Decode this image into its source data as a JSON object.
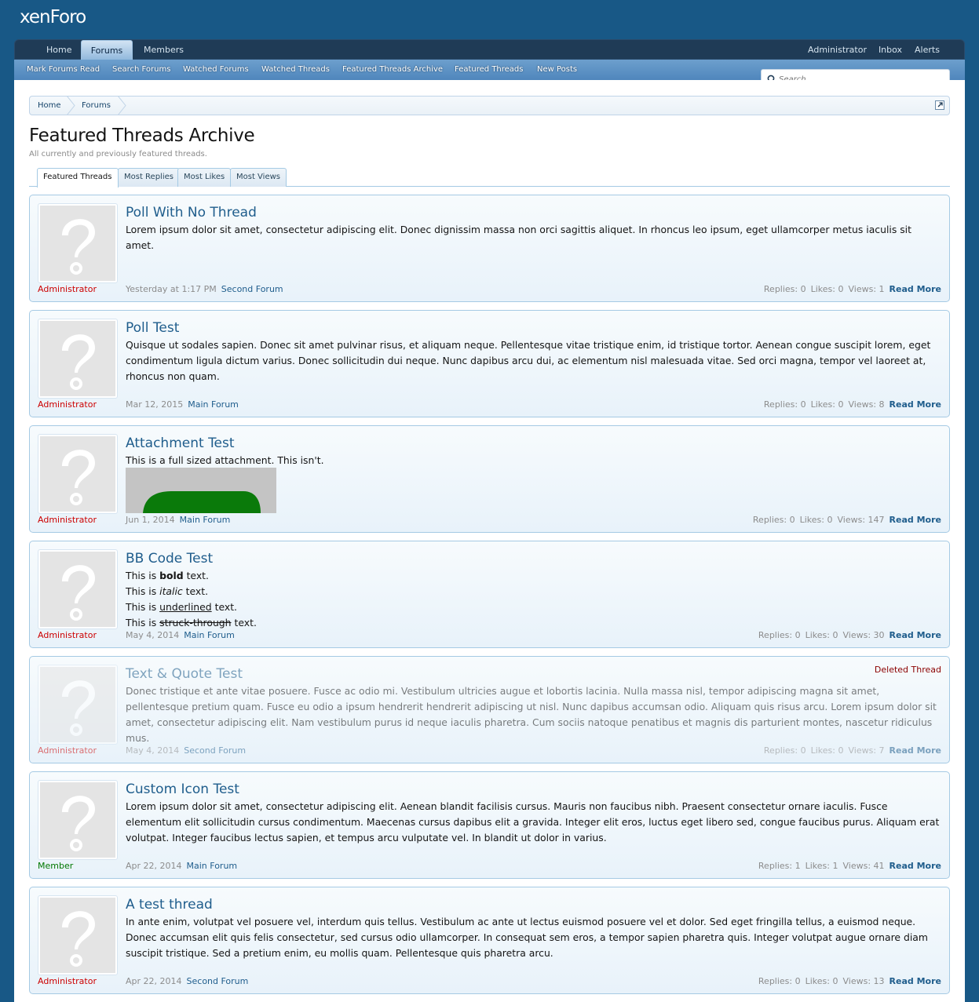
{
  "header": {
    "logo": "xenForo"
  },
  "nav": {
    "tabs": [
      {
        "label": "Home"
      },
      {
        "label": "Forums"
      },
      {
        "label": "Members"
      }
    ],
    "right": [
      {
        "label": "Administrator"
      },
      {
        "label": "Inbox"
      },
      {
        "label": "Alerts"
      }
    ]
  },
  "subnav": {
    "items": [
      {
        "label": "Mark Forums Read"
      },
      {
        "label": "Search Forums"
      },
      {
        "label": "Watched Forums"
      },
      {
        "label": "Watched Threads"
      },
      {
        "label": "Featured Threads Archive"
      },
      {
        "label": "Featured Threads"
      },
      {
        "label": "New Posts"
      }
    ]
  },
  "search": {
    "placeholder": "Search..."
  },
  "breadcrumb": {
    "items": [
      {
        "label": "Home"
      },
      {
        "label": "Forums"
      }
    ]
  },
  "page": {
    "title": "Featured Threads Archive",
    "description": "All currently and previously featured threads."
  },
  "tabs": [
    {
      "label": "Featured Threads"
    },
    {
      "label": "Most Replies"
    },
    {
      "label": "Most Likes"
    },
    {
      "label": "Most Views"
    }
  ],
  "threads": [
    {
      "title": "Poll With No Thread",
      "body": "Lorem ipsum dolor sit amet, consectetur adipiscing elit. Donec dignissim massa non orci sagittis aliquet. In rhoncus leo ipsum, eget ullamcorper metus iaculis sit amet.",
      "author": "Administrator",
      "date": "Yesterday at 1:17 PM",
      "forum": "Second Forum",
      "replies": "Replies: 0",
      "likes": "Likes: 0",
      "views": "Views: 1",
      "read_more": "Read More"
    },
    {
      "title": "Poll Test",
      "body": "Quisque ut sodales sapien. Donec sit amet pulvinar risus, et aliquam neque. Pellentesque vitae tristique enim, id tristique tortor. Aenean congue suscipit lorem, eget condimentum ligula dictum varius. Donec sollicitudin dui neque. Nunc dapibus arcu dui, ac elementum nisl malesuada vitae. Sed orci magna, tempor vel laoreet at, rhoncus non quam.",
      "author": "Administrator",
      "date": "Mar 12, 2015",
      "forum": "Main Forum",
      "replies": "Replies: 0",
      "likes": "Likes: 0",
      "views": "Views: 8",
      "read_more": "Read More"
    },
    {
      "title": "Attachment Test",
      "body": "This is a full sized attachment. This isn't.",
      "author": "Administrator",
      "date": "Jun 1, 2014",
      "forum": "Main Forum",
      "replies": "Replies: 0",
      "likes": "Likes: 0",
      "views": "Views: 147",
      "read_more": "Read More"
    },
    {
      "title": "BB Code Test",
      "lines": {
        "prefix": "This is",
        "suffix": "text.",
        "bold": "bold",
        "italic": "italic",
        "underlined": "underlined",
        "struck": "struck-through"
      },
      "author": "Administrator",
      "date": "May 4, 2014",
      "forum": "Main Forum",
      "replies": "Replies: 0",
      "likes": "Likes: 0",
      "views": "Views: 30",
      "read_more": "Read More"
    },
    {
      "title": "Text & Quote Test",
      "deleted_label": "Deleted Thread",
      "body": "Donec tristique et ante vitae posuere. Fusce ac odio mi. Vestibulum ultricies augue et lobortis lacinia. Nulla massa nisl, tempor adipiscing magna sit amet, pellentesque pretium quam. Fusce eu odio a ipsum hendrerit hendrerit adipiscing ut nisl. Nunc dapibus accumsan odio. Aliquam quis risus arcu. Lorem ipsum dolor sit amet, consectetur adipiscing elit. Nam vestibulum purus id neque iaculis pharetra. Cum sociis natoque penatibus et magnis dis parturient montes, nascetur ridiculus mus.",
      "author": "Administrator",
      "date": "May 4, 2014",
      "forum": "Second Forum",
      "replies": "Replies: 0",
      "likes": "Likes: 0",
      "views": "Views: 7",
      "read_more": "Read More"
    },
    {
      "title": "Custom Icon Test",
      "body": "Lorem ipsum dolor sit amet, consectetur adipiscing elit. Aenean blandit facilisis cursus. Mauris non faucibus nibh. Praesent consectetur ornare iaculis. Fusce elementum elit sollicitudin cursus condimentum. Maecenas cursus dapibus elit a gravida. Integer elit eros, luctus eget libero sed, congue faucibus purus. Aliquam erat volutpat. Integer faucibus lectus sapien, et tempus arcu vulputate vel. In blandit ut dolor in varius.",
      "author": "Member",
      "date": "Apr 22, 2014",
      "forum": "Main Forum",
      "replies": "Replies: 1",
      "likes": "Likes: 1",
      "views": "Views: 41",
      "read_more": "Read More"
    },
    {
      "title": "A test thread",
      "body": "In ante enim, volutpat vel posuere vel, interdum quis tellus. Vestibulum ac ante ut lectus euismod posuere vel et dolor. Sed eget fringilla tellus, a euismod neque. Donec accumsan elit quis felis consectetur, sed cursus odio ullamcorper. In consequat sem eros, a tempor sapien pharetra quis. Integer volutpat augue ornare diam suscipit tristique. Sed a pretium enim, eu mollis quam. Pellentesque quis pharetra arcu.",
      "author": "Administrator",
      "date": "Apr 22, 2014",
      "forum": "Second Forum",
      "replies": "Replies: 0",
      "likes": "Likes: 0",
      "views": "Views: 13",
      "read_more": "Read More"
    }
  ],
  "colors": {
    "header": "#185886",
    "link": "#1f5d8c",
    "admin": "#cc0000",
    "member": "#007700"
  }
}
